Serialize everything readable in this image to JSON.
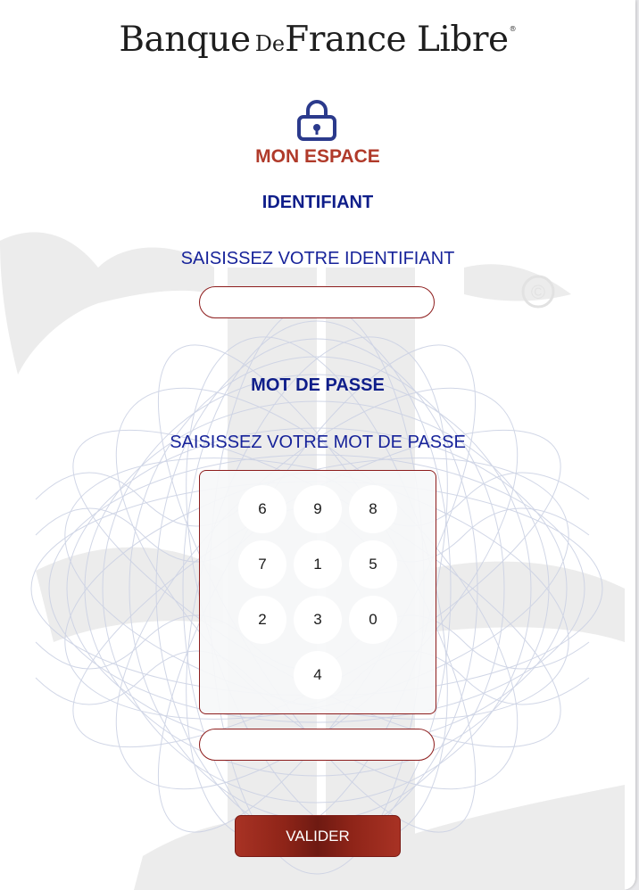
{
  "logo": {
    "banque": "Banque",
    "de": "De",
    "france_libre": "France Libre",
    "reg": "®"
  },
  "login": {
    "section_title": "MON ESPACE",
    "identifiant_title": "IDENTIFIANT",
    "identifiant_prompt": "SAISISSEZ VOTRE IDENTIFIANT",
    "identifiant_value": "",
    "password_title": "MOT DE PASSE",
    "password_prompt": "SAISISSEZ VOTRE MOT DE PASSE",
    "password_value": "",
    "keypad": [
      "6",
      "9",
      "8",
      "7",
      "1",
      "5",
      "2",
      "3",
      "0",
      "4"
    ],
    "submit_label": "VALIDER"
  },
  "watermark": {
    "copyright": "©"
  },
  "colors": {
    "accent_red": "#b03a2a",
    "navy": "#0f1e8a",
    "border_red": "#8d1c1c",
    "button_red": "#8e2418"
  },
  "icons": {
    "lock": "lock-icon"
  }
}
